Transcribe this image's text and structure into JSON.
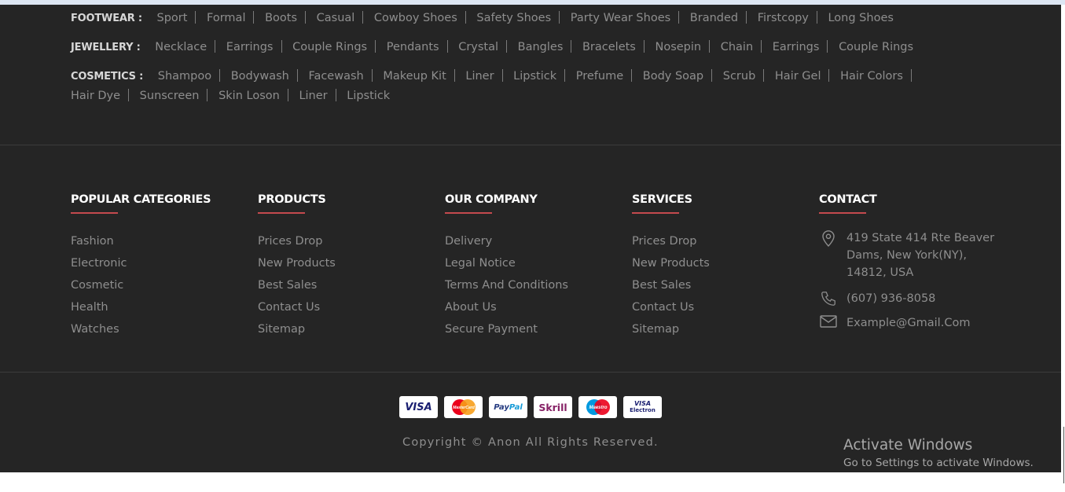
{
  "categories": {
    "footwear": {
      "title": "FOOTWEAR :",
      "links": [
        "Sport",
        "Formal",
        "Boots",
        "Casual",
        "Cowboy Shoes",
        "Safety Shoes",
        "Party Wear Shoes",
        "Branded",
        "Firstcopy",
        "Long Shoes"
      ]
    },
    "jewellery": {
      "title": "JEWELLERY :",
      "links": [
        "Necklace",
        "Earrings",
        "Couple Rings",
        "Pendants",
        "Crystal",
        "Bangles",
        "Bracelets",
        "Nosepin",
        "Chain",
        "Earrings",
        "Couple Rings"
      ]
    },
    "cosmetics": {
      "title": "COSMETICS :",
      "links": [
        "Shampoo",
        "Bodywash",
        "Facewash",
        "Makeup Kit",
        "Liner",
        "Lipstick",
        "Prefume",
        "Body Soap",
        "Scrub",
        "Hair Gel",
        "Hair Colors",
        "Hair Dye",
        "Sunscreen",
        "Skin Loson",
        "Liner",
        "Lipstick"
      ]
    }
  },
  "columns": {
    "popular": {
      "title": "POPULAR CATEGORIES",
      "links": [
        "Fashion",
        "Electronic",
        "Cosmetic",
        "Health",
        "Watches"
      ]
    },
    "products": {
      "title": "PRODUCTS",
      "links": [
        "Prices Drop",
        "New Products",
        "Best Sales",
        "Contact Us",
        "Sitemap"
      ]
    },
    "company": {
      "title": "OUR COMPANY",
      "links": [
        "Delivery",
        "Legal Notice",
        "Terms And Conditions",
        "About Us",
        "Secure Payment"
      ]
    },
    "services": {
      "title": "SERVICES",
      "links": [
        "Prices Drop",
        "New Products",
        "Best Sales",
        "Contact Us",
        "Sitemap"
      ]
    },
    "contact": {
      "title": "CONTACT",
      "address": [
        "419 State 414 Rte Beaver",
        "Dams, New York(NY),",
        "14812, USA"
      ],
      "phone": "(607) 936-8058",
      "email": "Example@Gmail.Com"
    }
  },
  "payments": [
    {
      "label": "VISA",
      "color": "#1a1f71"
    },
    {
      "label": "MasterCard",
      "color": "#eb001b"
    },
    {
      "label": "PayPal",
      "color": "#253b80"
    },
    {
      "label": "Skrill",
      "color": "#862165"
    },
    {
      "label": "Maestro",
      "color": "#0099df"
    },
    {
      "label": "VISA Electron",
      "color": "#1a1f71"
    }
  ],
  "copyright": "Copyright © Anon All Rights Reserved.",
  "activate": {
    "title": "Activate Windows",
    "subtitle": "Go to Settings to activate Windows."
  },
  "colors": {
    "background": "#252525",
    "accent": "#c44a4e",
    "text": "#8e8e8e",
    "heading": "#ffffff"
  }
}
